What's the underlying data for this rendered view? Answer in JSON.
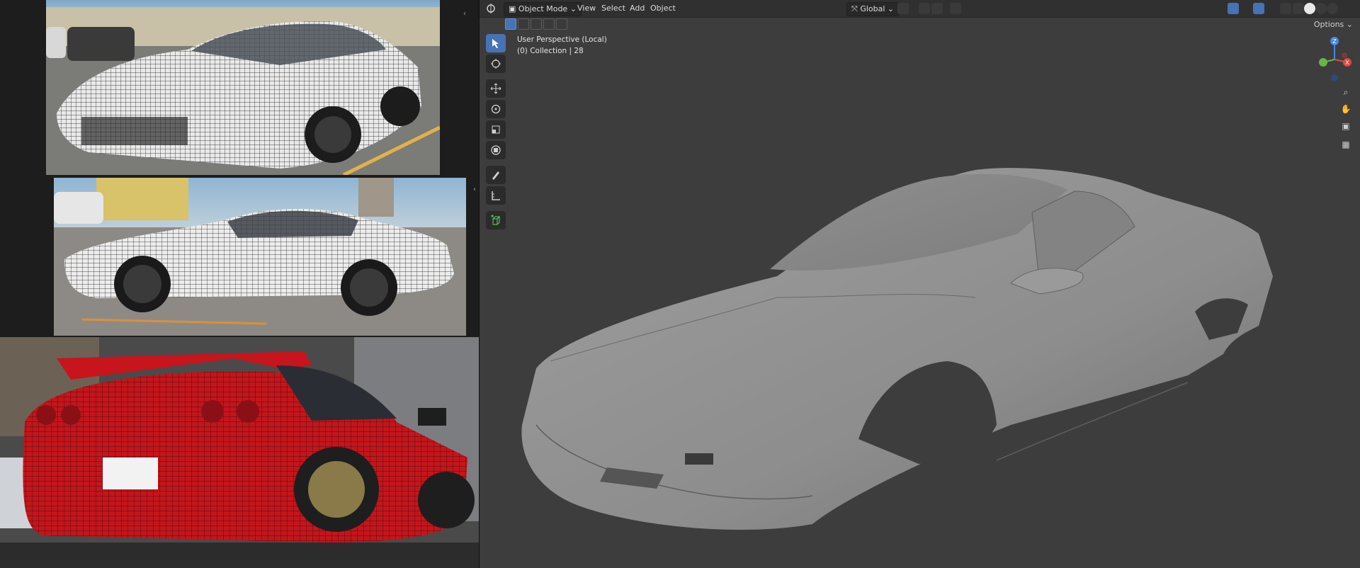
{
  "viewport": {
    "mode_label": "Object Mode",
    "menus": [
      "View",
      "Select",
      "Add",
      "Object"
    ],
    "transform_orientation": "Global",
    "options_label": "Options",
    "overlay_line1": "User Perspective (Local)",
    "overlay_line2": "(0) Collection | 28",
    "gizmo_axes": {
      "z": "Z",
      "x": "X"
    }
  },
  "tools": [
    "select-box",
    "cursor",
    "move",
    "rotate",
    "scale",
    "transform",
    "annotate",
    "measure",
    "add-cube"
  ],
  "colors": {
    "viewport_bg": "#3d3d3d",
    "header_bg": "#303030",
    "active_blue": "#4772b3",
    "axis_x": "#e04848",
    "axis_y": "#6bb24a",
    "axis_z": "#4a86e0"
  }
}
